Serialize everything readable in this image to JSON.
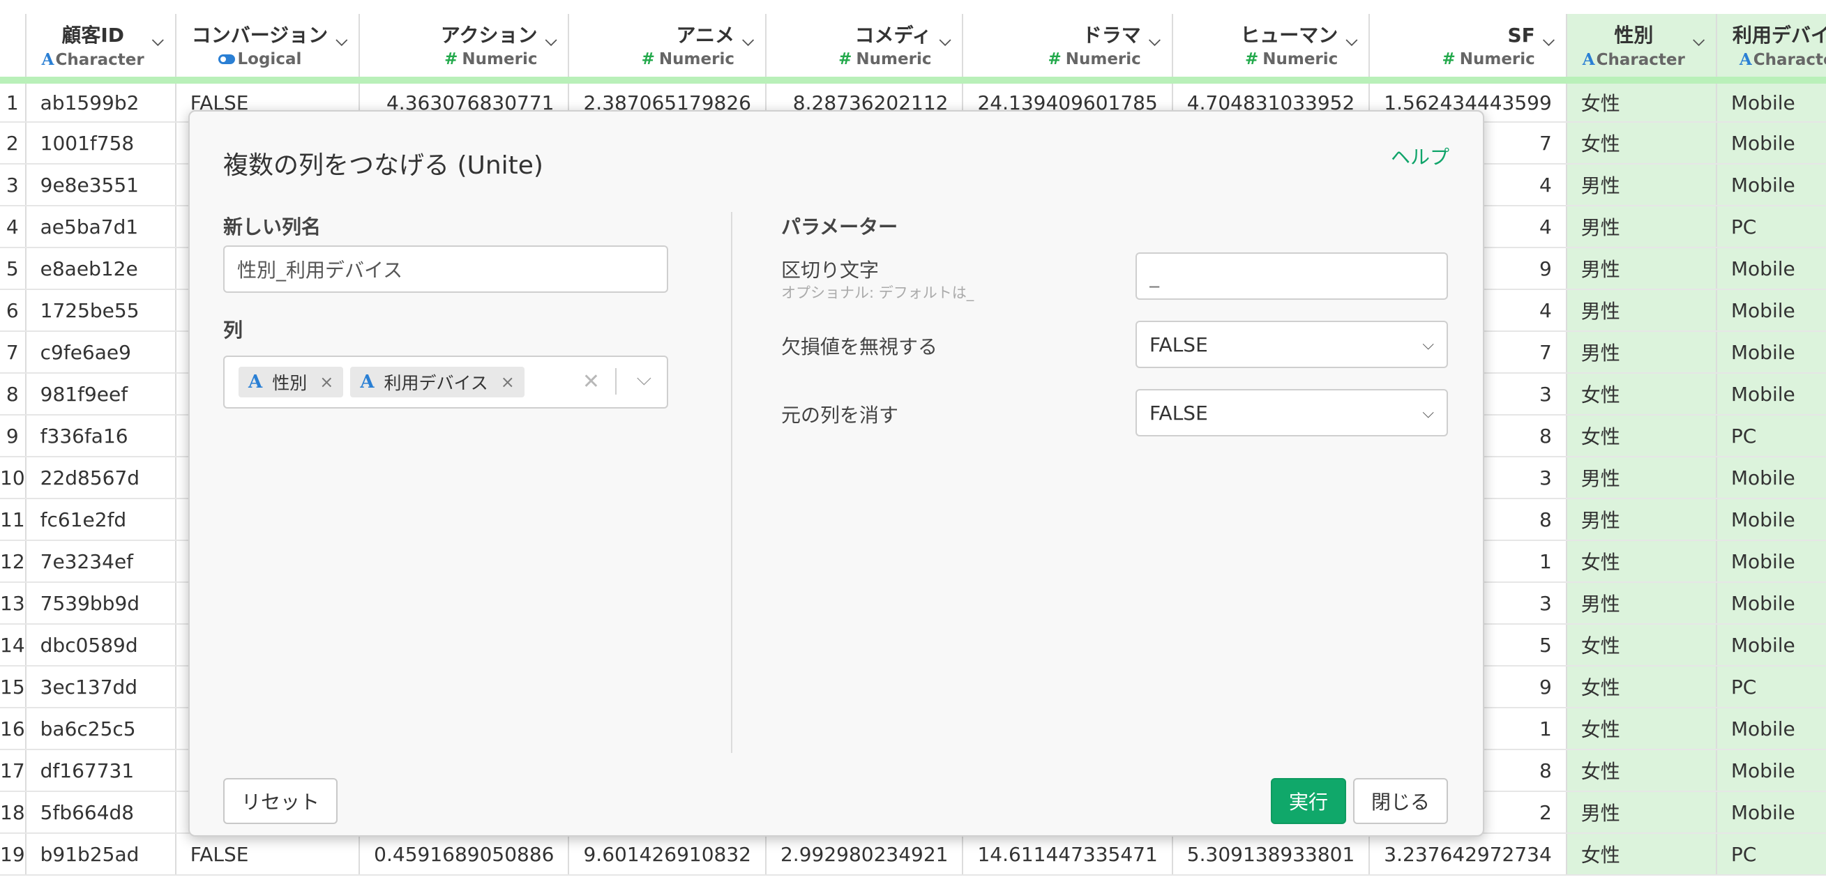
{
  "columns": [
    {
      "name": "顧客ID",
      "type": "Character",
      "kind": "char"
    },
    {
      "name": "コンバージョン",
      "type": "Logical",
      "kind": "log"
    },
    {
      "name": "アクション",
      "type": "Numeric",
      "kind": "num"
    },
    {
      "name": "アニメ",
      "type": "Numeric",
      "kind": "num"
    },
    {
      "name": "コメディ",
      "type": "Numeric",
      "kind": "num"
    },
    {
      "name": "ドラマ",
      "type": "Numeric",
      "kind": "num"
    },
    {
      "name": "ヒューマン",
      "type": "Numeric",
      "kind": "num"
    },
    {
      "name": "SF",
      "type": "Numeric",
      "kind": "num"
    },
    {
      "name": "性別",
      "type": "Character",
      "kind": "char",
      "selected": true
    },
    {
      "name": "利用デバイス",
      "type": "Character",
      "kind": "char",
      "selected": true
    }
  ],
  "rows": [
    [
      "1",
      "ab1599b2",
      "FALSE",
      "4.363076830771",
      "2.387065179826",
      "8.28736202112",
      "24.139409601785",
      "4.704831033952",
      "1.562434443599",
      "女性",
      "Mobile"
    ],
    [
      "2",
      "1001f758",
      "",
      "",
      "",
      "",
      "",
      "",
      "7",
      "女性",
      "Mobile"
    ],
    [
      "3",
      "9e8e3551",
      "",
      "",
      "",
      "",
      "",
      "",
      "4",
      "男性",
      "Mobile"
    ],
    [
      "4",
      "ae5ba7d1",
      "",
      "",
      "",
      "",
      "",
      "",
      "4",
      "男性",
      "PC"
    ],
    [
      "5",
      "e8aeb12e",
      "",
      "",
      "",
      "",
      "",
      "",
      "9",
      "男性",
      "Mobile"
    ],
    [
      "6",
      "1725be55",
      "",
      "",
      "",
      "",
      "",
      "",
      "4",
      "男性",
      "Mobile"
    ],
    [
      "7",
      "c9fe6ae9",
      "",
      "",
      "",
      "",
      "",
      "",
      "7",
      "男性",
      "Mobile"
    ],
    [
      "8",
      "981f9eef",
      "",
      "",
      "",
      "",
      "",
      "",
      "3",
      "女性",
      "Mobile"
    ],
    [
      "9",
      "f336fa16",
      "",
      "",
      "",
      "",
      "",
      "",
      "8",
      "女性",
      "PC"
    ],
    [
      "10",
      "22d8567d",
      "",
      "",
      "",
      "",
      "",
      "",
      "3",
      "男性",
      "Mobile"
    ],
    [
      "11",
      "fc61e2fd",
      "",
      "",
      "",
      "",
      "",
      "",
      "8",
      "男性",
      "Mobile"
    ],
    [
      "12",
      "7e3234ef",
      "",
      "",
      "",
      "",
      "",
      "",
      "1",
      "女性",
      "Mobile"
    ],
    [
      "13",
      "7539bb9d",
      "",
      "",
      "",
      "",
      "",
      "",
      "3",
      "男性",
      "Mobile"
    ],
    [
      "14",
      "dbc0589d",
      "",
      "",
      "",
      "",
      "",
      "",
      "5",
      "女性",
      "Mobile"
    ],
    [
      "15",
      "3ec137dd",
      "",
      "",
      "",
      "",
      "",
      "",
      "9",
      "女性",
      "PC"
    ],
    [
      "16",
      "ba6c25c5",
      "",
      "",
      "",
      "",
      "",
      "",
      "1",
      "女性",
      "Mobile"
    ],
    [
      "17",
      "df167731",
      "",
      "",
      "",
      "",
      "",
      "",
      "8",
      "女性",
      "Mobile"
    ],
    [
      "18",
      "5fb664d8",
      "",
      "",
      "",
      "",
      "",
      "",
      "2",
      "男性",
      "Mobile"
    ],
    [
      "19",
      "b91b25ad",
      "FALSE",
      "0.4591689050886",
      "9.601426910832",
      "2.992980234921",
      "14.611447335471",
      "5.309138933801",
      "3.237642972734",
      "女性",
      "PC"
    ]
  ],
  "dialog": {
    "title": "複数の列をつなげる (Unite)",
    "help": "ヘルプ",
    "new_col_label": "新しい列名",
    "new_col_value": "性別_利用デバイス",
    "cols_label": "列",
    "chips": [
      {
        "icon": "A",
        "label": "性別"
      },
      {
        "icon": "A",
        "label": "利用デバイス"
      }
    ],
    "params_label": "パラメーター",
    "sep_label": "区切り文字",
    "sep_hint": "オプショナル: デフォルトは_",
    "sep_placeholder": "_",
    "na_label": "欠損値を無視する",
    "na_value": "FALSE",
    "remove_label": "元の列を消す",
    "remove_value": "FALSE",
    "reset": "リセット",
    "run": "実行",
    "close": "閉じる"
  },
  "colors": {
    "accent_green": "#10a86a",
    "selected_col_bg": "#dcf3dc",
    "char_type_blue": "#2a7fd4",
    "num_type_green": "#22a94b"
  }
}
